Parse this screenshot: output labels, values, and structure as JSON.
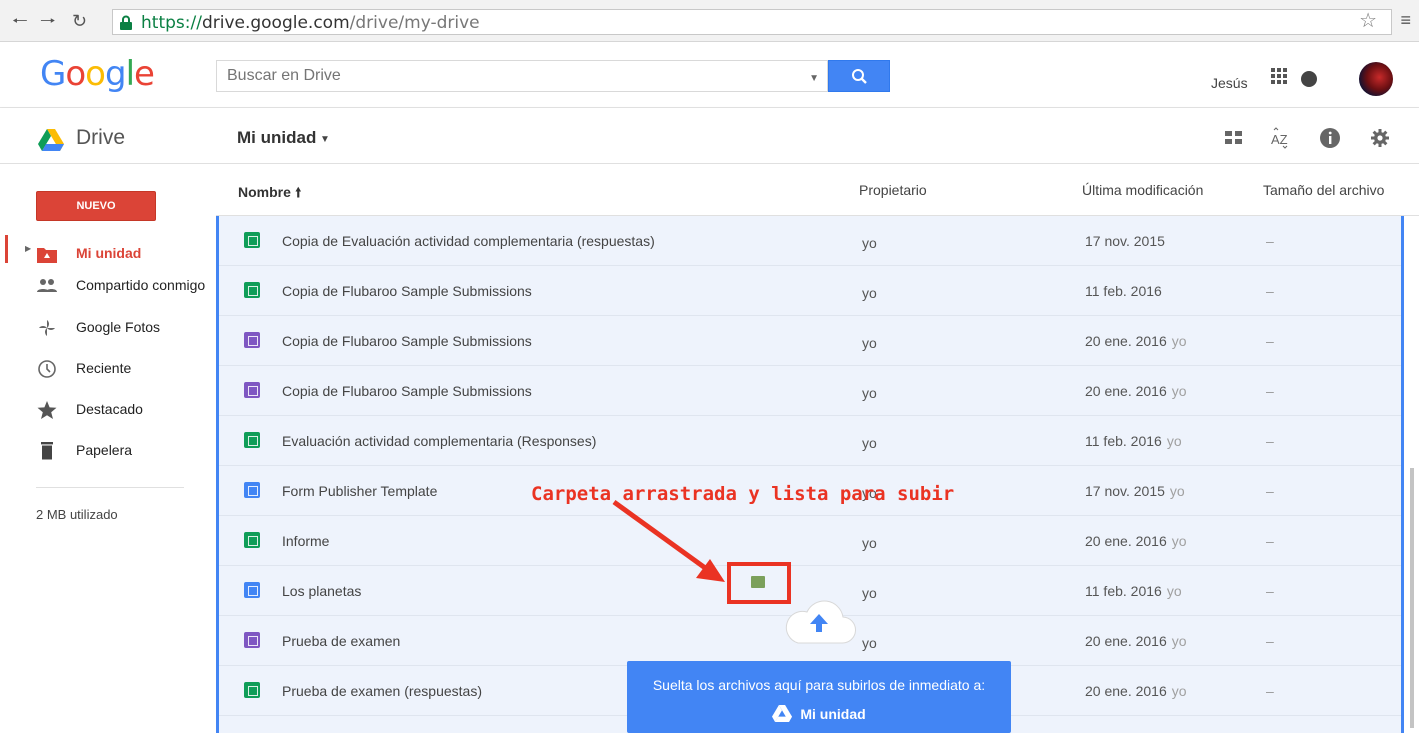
{
  "browser": {
    "url_scheme": "https://",
    "url_host": "drive.google.com",
    "url_path": "/drive/my-drive"
  },
  "header": {
    "search_placeholder": "Buscar en Drive",
    "user_name": "Jesús"
  },
  "drivebar": {
    "app_name": "Drive",
    "location": "Mi unidad"
  },
  "sidebar": {
    "new_button": "NUEVO",
    "items": [
      {
        "label": "Mi unidad",
        "icon": "my-drive-icon"
      },
      {
        "label": "Compartido conmigo",
        "icon": "shared-people-icon"
      },
      {
        "label": "Google Fotos",
        "icon": "photos-pinwheel-icon"
      },
      {
        "label": "Reciente",
        "icon": "clock-icon"
      },
      {
        "label": "Destacado",
        "icon": "star-icon"
      },
      {
        "label": "Papelera",
        "icon": "trash-icon"
      }
    ],
    "storage": "2 MB utilizado"
  },
  "table": {
    "columns": [
      "Nombre",
      "Propietario",
      "Última modificación",
      "Tamaño del archivo"
    ],
    "rows": [
      {
        "type": "sheet",
        "name": "Copia de Evaluación actividad complementaria (respuestas)",
        "owner": "yo",
        "modified": "17 nov. 2015",
        "modified_by": "",
        "size": "–"
      },
      {
        "type": "sheet",
        "name": "Copia de Flubaroo Sample Submissions",
        "owner": "yo",
        "modified": "11 feb. 2016",
        "modified_by": "",
        "size": "–"
      },
      {
        "type": "form",
        "name": "Copia de Flubaroo Sample Submissions",
        "owner": "yo",
        "modified": "20 ene. 2016",
        "modified_by": "yo",
        "size": "–"
      },
      {
        "type": "form",
        "name": "Copia de Flubaroo Sample Submissions",
        "owner": "yo",
        "modified": "20 ene. 2016",
        "modified_by": "yo",
        "size": "–"
      },
      {
        "type": "sheet",
        "name": "Evaluación actividad complementaria (Responses)",
        "owner": "yo",
        "modified": "11 feb. 2016",
        "modified_by": "yo",
        "size": "–"
      },
      {
        "type": "doc",
        "name": "Form Publisher Template",
        "owner": "yo",
        "modified": "17 nov. 2015",
        "modified_by": "yo",
        "size": "–"
      },
      {
        "type": "sheet",
        "name": "Informe",
        "owner": "yo",
        "modified": "20 ene. 2016",
        "modified_by": "yo",
        "size": "–"
      },
      {
        "type": "doc",
        "name": "Los planetas",
        "owner": "yo",
        "modified": "11 feb. 2016",
        "modified_by": "yo",
        "size": "–"
      },
      {
        "type": "form",
        "name": "Prueba de examen",
        "owner": "yo",
        "modified": "20 ene. 2016",
        "modified_by": "yo",
        "size": "–"
      },
      {
        "type": "sheet",
        "name": "Prueba de examen (respuestas)",
        "owner": "yo",
        "modified": "20 ene. 2016",
        "modified_by": "yo",
        "size": "–"
      }
    ]
  },
  "annotation": "Carpeta arrastrada y lista para subir",
  "upload_toast": {
    "text": "Suelta los archivos aquí para subirlos de inmediato a:",
    "target": "Mi unidad"
  },
  "colors": {
    "accent_red": "#db4437",
    "accent_blue": "#4285f4",
    "sheet_green": "#0f9d58",
    "form_purple": "#7e57c2",
    "annotation_red": "#ea3323"
  }
}
